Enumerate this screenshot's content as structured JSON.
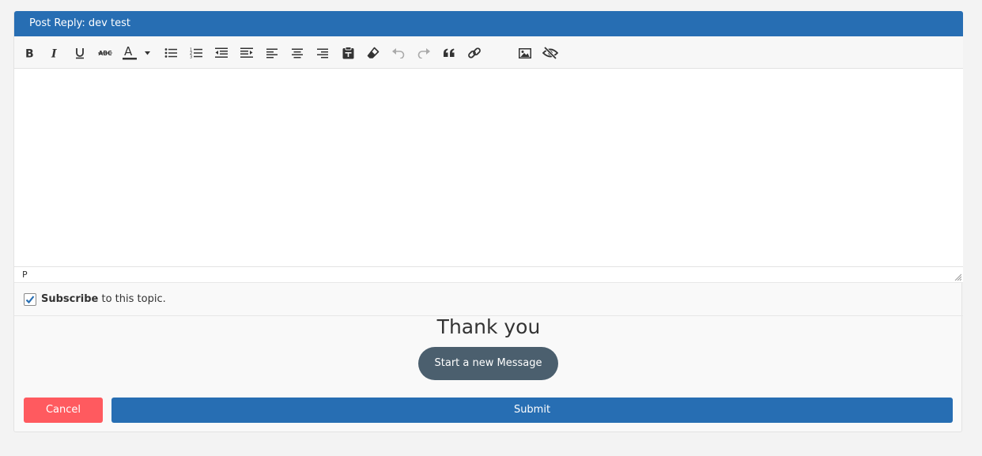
{
  "header": {
    "title": "Post Reply: dev test"
  },
  "toolbar": {
    "buttons": [
      "bold-icon",
      "italic-icon",
      "underline-icon",
      "strikethrough-icon",
      "text-color-icon",
      "bullet-list-icon",
      "numbered-list-icon",
      "outdent-icon",
      "indent-icon",
      "align-left-icon",
      "align-center-icon",
      "align-right-icon",
      "paste-icon",
      "eraser-icon",
      "undo-icon",
      "redo-icon",
      "blockquote-icon",
      "link-icon",
      "image-icon",
      "hide-icon"
    ]
  },
  "editor": {
    "content": "",
    "path": "P"
  },
  "subscribe": {
    "checked": true,
    "bold_label": "Subscribe",
    "label_rest": " to this topic."
  },
  "thanks": {
    "text": "Thank you"
  },
  "actions": {
    "new_message_label": "Start a new Message",
    "cancel_label": "Cancel",
    "submit_label": "Submit"
  },
  "colors": {
    "header": "#276eb3",
    "submit": "#276eb3",
    "cancel": "#ff5a5f",
    "new_message": "#4b5f6e"
  }
}
